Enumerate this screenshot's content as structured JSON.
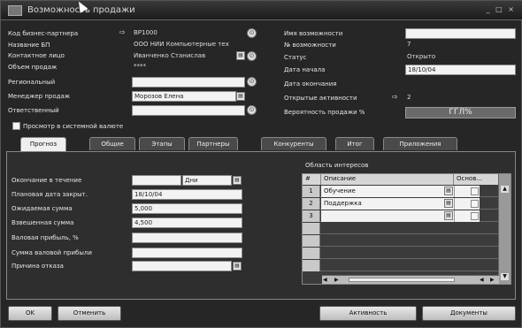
{
  "window": {
    "title": "Возможность продажи",
    "controls": "_ □ ×"
  },
  "left_form": {
    "fields": [
      {
        "label": "Код бизнес-партнера",
        "value": "BP1000"
      },
      {
        "label": "Название БП",
        "value": "ООО НИИ Компьютерные тех"
      },
      {
        "label": "Контактное лицо",
        "value": "Иванченко Станислав"
      },
      {
        "label": "Объем продаж",
        "value": "****"
      },
      {
        "label": "Региональный",
        "value": ""
      },
      {
        "label": "Менеджер продаж",
        "value": "Морозов Елена"
      },
      {
        "label": "Ответственный",
        "value": ""
      }
    ]
  },
  "right_form": {
    "fields": [
      {
        "label": "Имя возможности",
        "value": ""
      },
      {
        "label": "№ возможности",
        "value": "7"
      },
      {
        "label": "Статус",
        "value": "Открыто"
      },
      {
        "label": "Дата начала",
        "value": "18/10/04"
      },
      {
        "label": "Дата окончания",
        "value": ""
      },
      {
        "label": "Открытые активности",
        "value": "2"
      },
      {
        "label": "Вероятность продажи %",
        "value": "ГГЛ%"
      }
    ]
  },
  "system_currency_label": "Просмотр в системной валюте",
  "tabs": [
    "Прогноз",
    "Общие",
    "Этапы",
    "Партнеры",
    "Конкуренты",
    "Итог",
    "Приложения"
  ],
  "forecast": {
    "fields": [
      {
        "label": "Окончание в течение",
        "value": "",
        "unit": "Дни"
      },
      {
        "label": "Плановая дата закрыт.",
        "value": "18/10/04"
      },
      {
        "label": "Ожидаемая сумма",
        "value": "5,000"
      },
      {
        "label": "Взвешенная сумма",
        "value": "4,500"
      },
      {
        "label": "Валовая прибыль, %",
        "value": ""
      },
      {
        "label": "Сумма валовой прибыли",
        "value": ""
      },
      {
        "label": "Причина отказа",
        "value": ""
      }
    ]
  },
  "interests": {
    "title": "Область интересов",
    "headers": [
      "#",
      "Описание",
      "Основ..."
    ],
    "rows": [
      {
        "num": "1",
        "desc": "Обучение"
      },
      {
        "num": "2",
        "desc": "Поддержка"
      },
      {
        "num": "3",
        "desc": ""
      },
      {
        "num": "",
        "desc": ""
      },
      {
        "num": "",
        "desc": ""
      },
      {
        "num": "",
        "desc": ""
      },
      {
        "num": "",
        "desc": ""
      }
    ]
  },
  "buttons": {
    "ok": "OK",
    "cancel": "Отменить",
    "activity": "Активность",
    "documents": "Документы"
  }
}
